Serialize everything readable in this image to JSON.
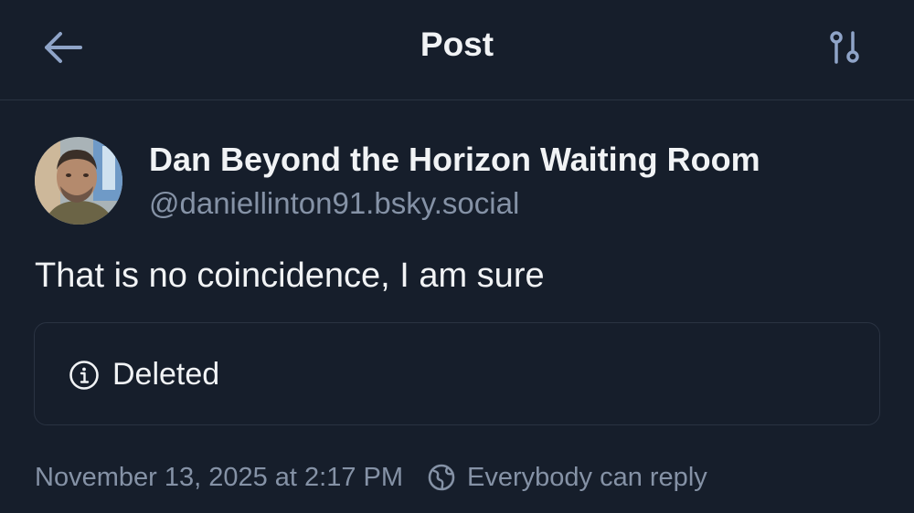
{
  "header": {
    "title": "Post",
    "back_icon": "arrow-left-icon",
    "filter_icon": "sliders-icon"
  },
  "post": {
    "author": {
      "display_name": "Dan Beyond the Horizon Waiting Room",
      "handle": "@daniellinton91.bsky.social"
    },
    "text": "That is no coincidence, I am sure",
    "quote": {
      "status_text": "Deleted",
      "icon": "info-icon"
    },
    "timestamp": "November 13, 2025 at 2:17 PM",
    "reply_setting": {
      "label": "Everybody can reply",
      "icon": "globe-icon"
    }
  },
  "colors": {
    "background": "#161e2b",
    "text_primary": "#f1f3f5",
    "text_secondary": "#8592a6",
    "border": "#2a3342"
  }
}
